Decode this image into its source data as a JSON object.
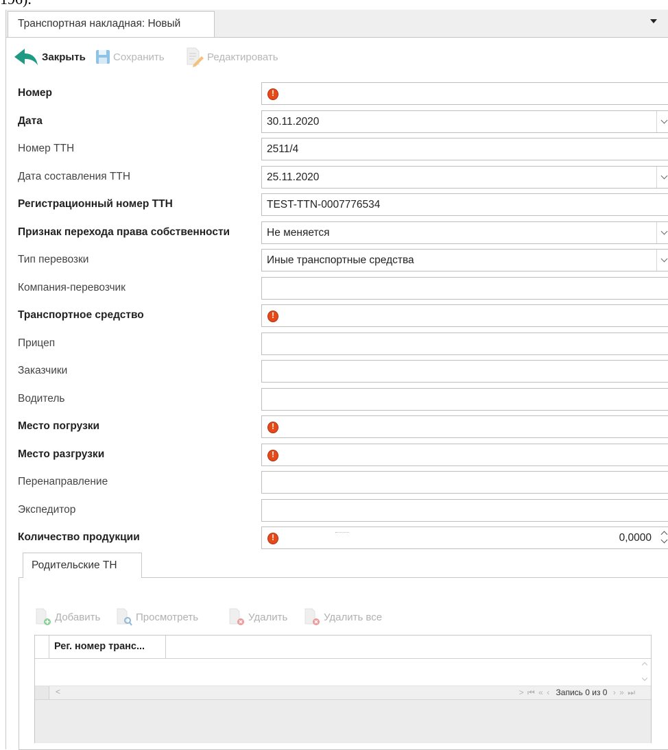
{
  "top_crop_text": "196).",
  "tab": {
    "title": "Транспортная накладная: Новый"
  },
  "toolbar": {
    "close": "Закрыть",
    "save": "Сохранить",
    "edit": "Редактировать"
  },
  "form": {
    "rows": [
      {
        "label": "Номер",
        "value": "",
        "required": true,
        "error": true
      },
      {
        "label": "Дата",
        "value": "30.11.2020",
        "required": true,
        "dropdown": true
      },
      {
        "label": "Номер ТТН",
        "value": "2511/4"
      },
      {
        "label": "Дата составления ТТН",
        "value": "25.11.2020",
        "dropdown": true
      },
      {
        "label": "Регистрационный номер ТТН",
        "value": "TEST-TTN-0007776534",
        "required": true
      },
      {
        "label": "Признак перехода права собственности",
        "value": "Не меняется",
        "required": true,
        "dropdown": true
      },
      {
        "label": "Тип перевозки",
        "value": "Иные транспортные средства",
        "dropdown": true
      },
      {
        "label": "Компания-перевозчик",
        "value": ""
      },
      {
        "label": "Транспортное средство",
        "value": "",
        "required": true,
        "error": true
      },
      {
        "label": "Прицеп",
        "value": ""
      },
      {
        "label": "Заказчики",
        "value": ""
      },
      {
        "label": "Водитель",
        "value": ""
      },
      {
        "label": "Место погрузки",
        "value": "",
        "required": true,
        "error": true
      },
      {
        "label": "Место разгрузки",
        "value": "",
        "required": true,
        "error": true
      },
      {
        "label": "Перенаправление",
        "value": ""
      },
      {
        "label": "Экспедитор",
        "value": ""
      },
      {
        "label": "Количество продукции",
        "value": "0,0000",
        "required": true,
        "error": true,
        "numeric": true
      }
    ]
  },
  "subpanel": {
    "tab": "Родительские ТН",
    "toolbar": {
      "add": "Добавить",
      "view": "Просмотреть",
      "delete": "Удалить",
      "delete_all": "Удалить все"
    },
    "grid": {
      "columns": [
        "Рег. номер транс..."
      ],
      "record_text": "Запись 0 из 0"
    }
  }
}
